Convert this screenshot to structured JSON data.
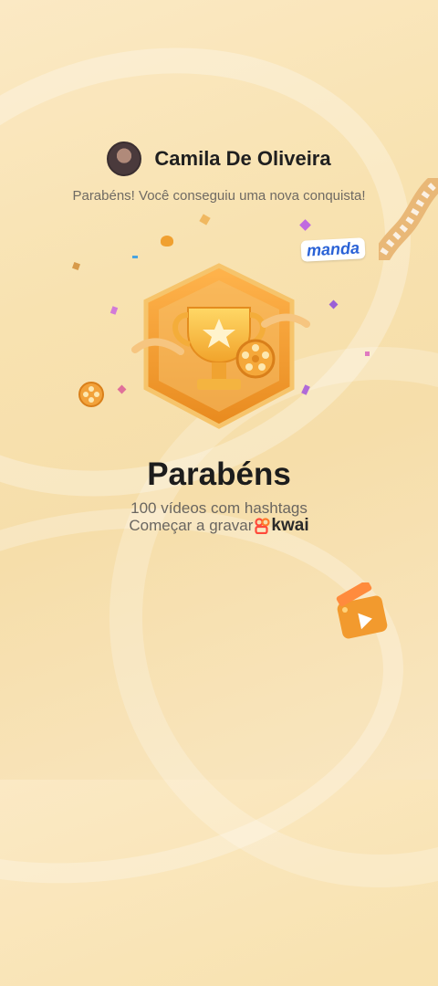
{
  "achievement": {
    "user_name": "Camila De Oliveira",
    "subtitle": "Parabéns! Você conseguiu uma nova conquista!",
    "title": "Parabéns",
    "description": "100 vídeos com hashtags",
    "cta_label": "Começar a gravar",
    "brand": "kwai",
    "sticker_text": "manda"
  },
  "icons": {
    "badge": "trophy-badge-icon",
    "brand_logo": "kwai-logo-icon",
    "reel": "film-reel-icon",
    "clapper": "clapperboard-icon"
  },
  "colors": {
    "background": "#f8e2b0",
    "badge_gold": "#f2a531",
    "brand_red": "#ff4a3a",
    "sticker_blue": "#2a62d6"
  }
}
